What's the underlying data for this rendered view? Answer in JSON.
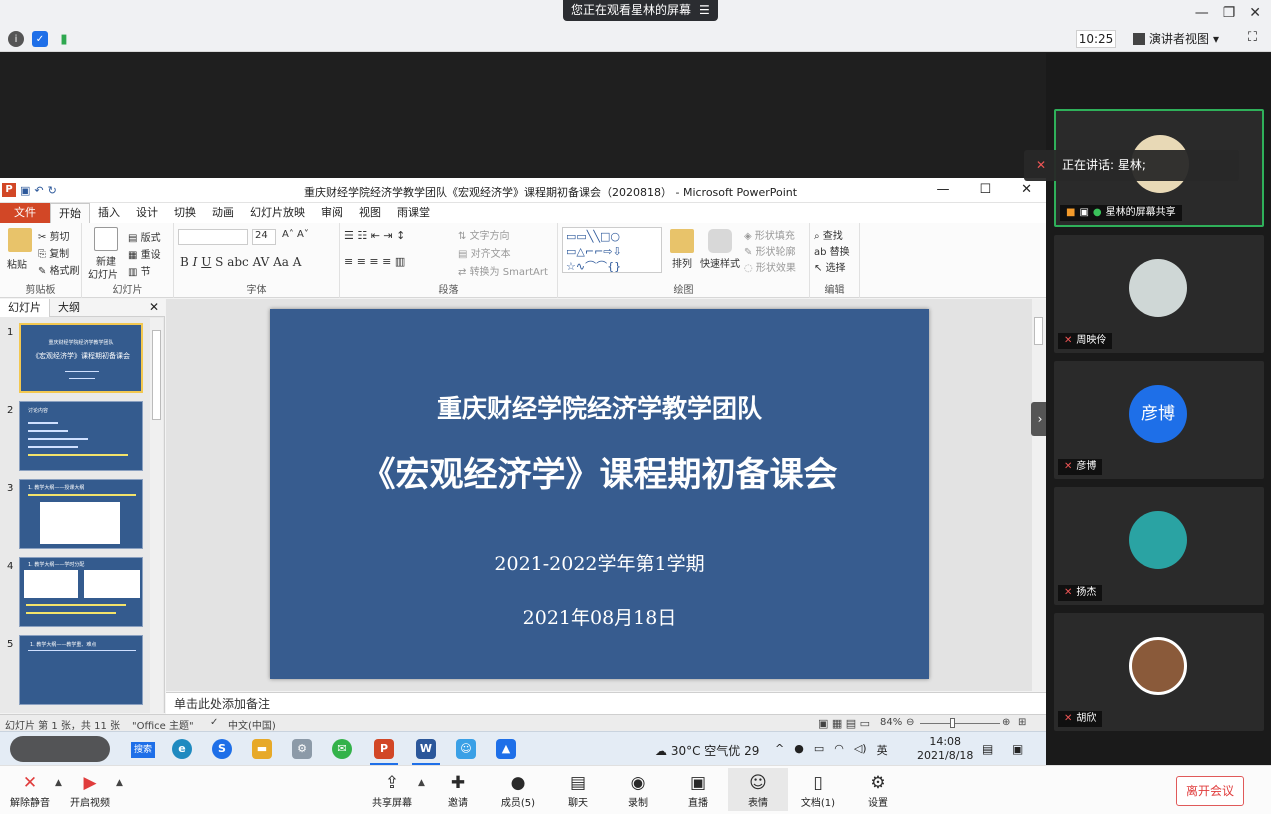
{
  "meeting": {
    "sharing_banner": "您正在观看星林的屏幕",
    "time": "10:25",
    "presenter_view": "演讲者视图",
    "speaking_banner": "正在讲话: 星林;",
    "leave_button": "离开会议"
  },
  "toolbar": {
    "unmute": "解除静音",
    "start_video": "开启视频",
    "share_screen": "共享屏幕",
    "invite": "邀请",
    "members": "成员(5)",
    "chat": "聊天",
    "record": "录制",
    "live": "直播",
    "reactions": "表情",
    "docs": "文档(1)",
    "settings": "设置"
  },
  "participants": [
    {
      "name": "星林的屏幕共享",
      "speaking": true
    },
    {
      "name": "周映伶"
    },
    {
      "name": "彦博",
      "initials": "彦博"
    },
    {
      "name": "扬杰"
    },
    {
      "name": "胡欣"
    }
  ],
  "ppt": {
    "window_title": "重庆财经学院经济学教学团队《宏观经济学》课程期初备课会（2020818） - Microsoft PowerPoint",
    "tabs": [
      "文件",
      "开始",
      "插入",
      "设计",
      "切换",
      "动画",
      "幻灯片放映",
      "审阅",
      "视图",
      "雨课堂"
    ],
    "ribbon": {
      "paste": "粘贴",
      "cut": "剪切",
      "copy": "复制",
      "format_painter": "格式刷",
      "clipboard": "剪贴板",
      "new_slide": "新建",
      "new_slide2": "幻灯片",
      "layout": "版式",
      "reset": "重设",
      "section": "节",
      "slides_group": "幻灯片",
      "font_size": "24",
      "font_group": "字体",
      "text_direction": "文字方向",
      "align_text": "对齐文本",
      "smartart": "转换为 SmartArt",
      "paragraph_group": "段落",
      "arrange": "排列",
      "quick_styles": "快速样式",
      "shape_fill": "形状填充",
      "shape_outline": "形状轮廓",
      "shape_effects": "形状效果",
      "drawing_group": "绘图",
      "find": "查找",
      "replace": "替换",
      "select": "选择",
      "editing_group": "编辑"
    },
    "panel_tabs": [
      "幻灯片",
      "大纲"
    ],
    "thumbnails": [
      {
        "num": "1",
        "line1": "重庆财经学院经济学教学团队",
        "line2": "《宏观经济学》课程期初备课会"
      },
      {
        "num": "2",
        "line1": "讨论内容"
      },
      {
        "num": "3",
        "line1": "1. 教学大纲——授课大纲"
      },
      {
        "num": "4",
        "line1": "1. 教学大纲——学时分配"
      },
      {
        "num": "5",
        "line1": "1. 教学大纲——教学重、难点"
      }
    ],
    "slide": {
      "line1": "重庆财经学院经济学教学团队",
      "line2": "《宏观经济学》课程期初备课会",
      "line3": "2021-2022学年第1学期",
      "line4": "2021年08月18日"
    },
    "notes_placeholder": "单击此处添加备注",
    "status": {
      "slide_count": "幻灯片 第 1 张，共 11 张",
      "theme": "\"Office 主题\"",
      "language": "中文(中国)",
      "zoom": "84%"
    }
  },
  "taskbar": {
    "search": "搜索",
    "weather": "30°C 空气优 29",
    "ime": "英",
    "clock_time": "14:08",
    "clock_date": "2021/8/18"
  }
}
